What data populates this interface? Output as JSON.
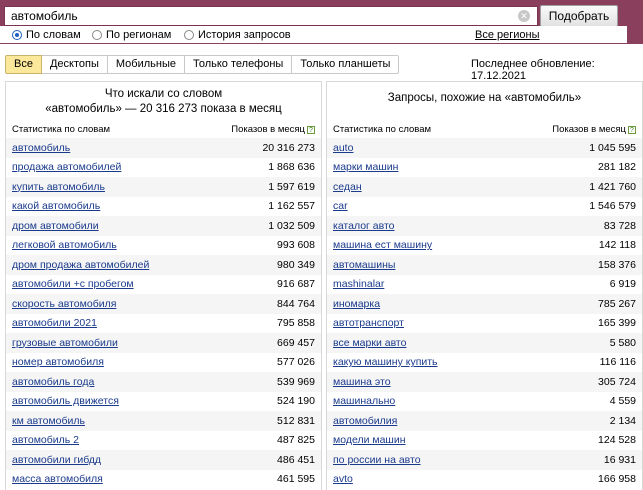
{
  "search": {
    "query": "автомобиль",
    "submit_label": "Подобрать"
  },
  "modes": [
    {
      "label": "По словам",
      "checked": true
    },
    {
      "label": "По регионам",
      "checked": false
    },
    {
      "label": "История запросов",
      "checked": false
    }
  ],
  "regions_label": "Все регионы",
  "tabs": [
    "Все",
    "Десктопы",
    "Мобильные",
    "Только телефоны",
    "Только планшеты"
  ],
  "updated": "Последнее обновление: 17.12.2021",
  "left": {
    "title1": "Что искали со словом",
    "title2": "«автомобиль» — 20 316 273 показа в месяц",
    "col_words": "Статистика по словам",
    "col_shows": "Показов в месяц",
    "rows": [
      {
        "phrase": "автомобиль",
        "count": "20 316 273"
      },
      {
        "phrase": "продажа автомобилей",
        "count": "1 868 636"
      },
      {
        "phrase": "купить автомобиль",
        "count": "1 597 619"
      },
      {
        "phrase": "какой автомобиль",
        "count": "1 162 557"
      },
      {
        "phrase": "дром автомобили",
        "count": "1 032 509"
      },
      {
        "phrase": "легковой автомобиль",
        "count": "993 608"
      },
      {
        "phrase": "дром продажа автомобилей",
        "count": "980 349"
      },
      {
        "phrase": "автомобили +с пробегом",
        "count": "916 687"
      },
      {
        "phrase": "скорость автомобиля",
        "count": "844 764"
      },
      {
        "phrase": "автомобили 2021",
        "count": "795 858"
      },
      {
        "phrase": "грузовые автомобили",
        "count": "669 457"
      },
      {
        "phrase": "номер автомобиля",
        "count": "577 026"
      },
      {
        "phrase": "автомобиль года",
        "count": "539 969"
      },
      {
        "phrase": "автомобиль движется",
        "count": "524 190"
      },
      {
        "phrase": "км автомобиль",
        "count": "512 831"
      },
      {
        "phrase": "автомобиль 2",
        "count": "487 825"
      },
      {
        "phrase": "автомобили гибдд",
        "count": "486 451"
      },
      {
        "phrase": "масса автомобиля",
        "count": "461 595"
      }
    ]
  },
  "right": {
    "title": "Запросы, похожие на «автомобиль»",
    "col_words": "Статистика по словам",
    "col_shows": "Показов в месяц",
    "rows": [
      {
        "phrase": "auto",
        "count": "1 045 595"
      },
      {
        "phrase": "марки машин",
        "count": "281 182"
      },
      {
        "phrase": "седан",
        "count": "1 421 760"
      },
      {
        "phrase": "car",
        "count": "1 546 579"
      },
      {
        "phrase": "каталог авто",
        "count": "83 728"
      },
      {
        "phrase": "машина ест машину",
        "count": "142 118"
      },
      {
        "phrase": "автомашины",
        "count": "158 376"
      },
      {
        "phrase": "mashinalar",
        "count": "6 919"
      },
      {
        "phrase": "иномарка",
        "count": "785 267"
      },
      {
        "phrase": "автотранспорт",
        "count": "165 399"
      },
      {
        "phrase": "все марки авто",
        "count": "5 580"
      },
      {
        "phrase": "какую машину купить",
        "count": "116 116"
      },
      {
        "phrase": "машина это",
        "count": "305 724"
      },
      {
        "phrase": "машинально",
        "count": "4 559"
      },
      {
        "phrase": "автомобилия",
        "count": "2 134"
      },
      {
        "phrase": "модели машин",
        "count": "124 528"
      },
      {
        "phrase": "по россии на авто",
        "count": "16 931"
      },
      {
        "phrase": "avto",
        "count": "166 958"
      }
    ]
  },
  "colors": {
    "band": "#8a3f5c",
    "tab_active": "#fbe89a",
    "link": "#1a3a8c"
  }
}
